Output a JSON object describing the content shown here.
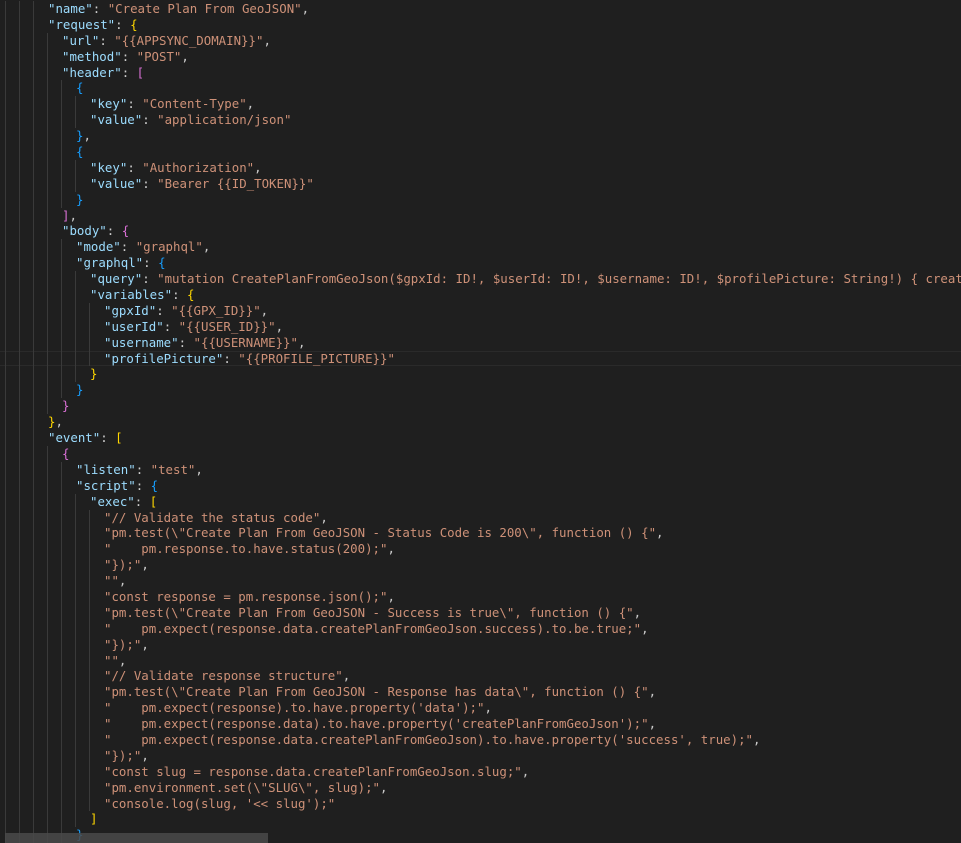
{
  "editor": {
    "lines": [
      [
        3,
        [
          [
            "k",
            "\"name\""
          ],
          [
            "p",
            ": "
          ],
          [
            "s",
            "\"Create Plan From GeoJSON\""
          ],
          [
            "p",
            ","
          ]
        ]
      ],
      [
        3,
        [
          [
            "k",
            "\"request\""
          ],
          [
            "p",
            ": "
          ],
          [
            "b1",
            "{"
          ]
        ]
      ],
      [
        4,
        [
          [
            "k",
            "\"url\""
          ],
          [
            "p",
            ": "
          ],
          [
            "s",
            "\"{{APPSYNC_DOMAIN}}\""
          ],
          [
            "p",
            ","
          ]
        ]
      ],
      [
        4,
        [
          [
            "k",
            "\"method\""
          ],
          [
            "p",
            ": "
          ],
          [
            "s",
            "\"POST\""
          ],
          [
            "p",
            ","
          ]
        ]
      ],
      [
        4,
        [
          [
            "k",
            "\"header\""
          ],
          [
            "p",
            ": "
          ],
          [
            "b2",
            "["
          ]
        ]
      ],
      [
        5,
        [
          [
            "b3",
            "{"
          ]
        ]
      ],
      [
        6,
        [
          [
            "k",
            "\"key\""
          ],
          [
            "p",
            ": "
          ],
          [
            "s",
            "\"Content-Type\""
          ],
          [
            "p",
            ","
          ]
        ]
      ],
      [
        6,
        [
          [
            "k",
            "\"value\""
          ],
          [
            "p",
            ": "
          ],
          [
            "s",
            "\"application/json\""
          ]
        ]
      ],
      [
        5,
        [
          [
            "b3",
            "}"
          ],
          [
            "p",
            ","
          ]
        ]
      ],
      [
        5,
        [
          [
            "b3",
            "{"
          ]
        ]
      ],
      [
        6,
        [
          [
            "k",
            "\"key\""
          ],
          [
            "p",
            ": "
          ],
          [
            "s",
            "\"Authorization\""
          ],
          [
            "p",
            ","
          ]
        ]
      ],
      [
        6,
        [
          [
            "k",
            "\"value\""
          ],
          [
            "p",
            ": "
          ],
          [
            "s",
            "\"Bearer {{ID_TOKEN}}\""
          ]
        ]
      ],
      [
        5,
        [
          [
            "b3",
            "}"
          ]
        ]
      ],
      [
        4,
        [
          [
            "b2",
            "]"
          ],
          [
            "p",
            ","
          ]
        ]
      ],
      [
        4,
        [
          [
            "k",
            "\"body\""
          ],
          [
            "p",
            ": "
          ],
          [
            "b2",
            "{"
          ]
        ]
      ],
      [
        5,
        [
          [
            "k",
            "\"mode\""
          ],
          [
            "p",
            ": "
          ],
          [
            "s",
            "\"graphql\""
          ],
          [
            "p",
            ","
          ]
        ]
      ],
      [
        5,
        [
          [
            "k",
            "\"graphql\""
          ],
          [
            "p",
            ": "
          ],
          [
            "b3",
            "{"
          ]
        ]
      ],
      [
        6,
        [
          [
            "k",
            "\"query\""
          ],
          [
            "p",
            ": "
          ],
          [
            "s",
            "\"mutation CreatePlanFromGeoJson($gpxId: ID!, $userId: ID!, $username: ID!, $profilePicture: String!) { createPlanFro"
          ]
        ]
      ],
      [
        6,
        [
          [
            "k",
            "\"variables\""
          ],
          [
            "p",
            ": "
          ],
          [
            "b1",
            "{"
          ]
        ]
      ],
      [
        7,
        [
          [
            "k",
            "\"gpxId\""
          ],
          [
            "p",
            ": "
          ],
          [
            "s",
            "\"{{GPX_ID}}\""
          ],
          [
            "p",
            ","
          ]
        ]
      ],
      [
        7,
        [
          [
            "k",
            "\"userId\""
          ],
          [
            "p",
            ": "
          ],
          [
            "s",
            "\"{{USER_ID}}\""
          ],
          [
            "p",
            ","
          ]
        ]
      ],
      [
        7,
        [
          [
            "k",
            "\"username\""
          ],
          [
            "p",
            ": "
          ],
          [
            "s",
            "\"{{USERNAME}}\""
          ],
          [
            "p",
            ","
          ]
        ]
      ],
      [
        7,
        [
          [
            "k",
            "\"profilePicture\""
          ],
          [
            "p",
            ": "
          ],
          [
            "s",
            "\"{{PROFILE_PICTURE}}\""
          ]
        ]
      ],
      [
        6,
        [
          [
            "b1",
            "}"
          ]
        ]
      ],
      [
        5,
        [
          [
            "b3",
            "}"
          ]
        ]
      ],
      [
        4,
        [
          [
            "b2",
            "}"
          ]
        ]
      ],
      [
        3,
        [
          [
            "b1",
            "}"
          ],
          [
            "p",
            ","
          ]
        ]
      ],
      [
        3,
        [
          [
            "k",
            "\"event\""
          ],
          [
            "p",
            ": "
          ],
          [
            "b1",
            "["
          ]
        ]
      ],
      [
        4,
        [
          [
            "b2",
            "{"
          ]
        ]
      ],
      [
        5,
        [
          [
            "k",
            "\"listen\""
          ],
          [
            "p",
            ": "
          ],
          [
            "s",
            "\"test\""
          ],
          [
            "p",
            ","
          ]
        ]
      ],
      [
        5,
        [
          [
            "k",
            "\"script\""
          ],
          [
            "p",
            ": "
          ],
          [
            "b3",
            "{"
          ]
        ]
      ],
      [
        6,
        [
          [
            "k",
            "\"exec\""
          ],
          [
            "p",
            ": "
          ],
          [
            "b1",
            "["
          ]
        ]
      ],
      [
        7,
        [
          [
            "s",
            "\"// Validate the status code\""
          ],
          [
            "p",
            ","
          ]
        ]
      ],
      [
        7,
        [
          [
            "s",
            "\"pm.test(\\\"Create Plan From GeoJSON - Status Code is 200\\\", function () {\""
          ],
          [
            "p",
            ","
          ]
        ]
      ],
      [
        7,
        [
          [
            "s",
            "\"    pm.response.to.have.status(200);\""
          ],
          [
            "p",
            ","
          ]
        ]
      ],
      [
        7,
        [
          [
            "s",
            "\"});\""
          ],
          [
            "p",
            ","
          ]
        ]
      ],
      [
        7,
        [
          [
            "s",
            "\"\""
          ],
          [
            "p",
            ","
          ]
        ]
      ],
      [
        7,
        [
          [
            "s",
            "\"const response = pm.response.json();\""
          ],
          [
            "p",
            ","
          ]
        ]
      ],
      [
        7,
        [
          [
            "s",
            "\"pm.test(\\\"Create Plan From GeoJSON - Success is true\\\", function () {\""
          ],
          [
            "p",
            ","
          ]
        ]
      ],
      [
        7,
        [
          [
            "s",
            "\"    pm.expect(response.data.createPlanFromGeoJson.success).to.be.true;\""
          ],
          [
            "p",
            ","
          ]
        ]
      ],
      [
        7,
        [
          [
            "s",
            "\"});\""
          ],
          [
            "p",
            ","
          ]
        ]
      ],
      [
        7,
        [
          [
            "s",
            "\"\""
          ],
          [
            "p",
            ","
          ]
        ]
      ],
      [
        7,
        [
          [
            "s",
            "\"// Validate response structure\""
          ],
          [
            "p",
            ","
          ]
        ]
      ],
      [
        7,
        [
          [
            "s",
            "\"pm.test(\\\"Create Plan From GeoJSON - Response has data\\\", function () {\""
          ],
          [
            "p",
            ","
          ]
        ]
      ],
      [
        7,
        [
          [
            "s",
            "\"    pm.expect(response).to.have.property('data');\""
          ],
          [
            "p",
            ","
          ]
        ]
      ],
      [
        7,
        [
          [
            "s",
            "\"    pm.expect(response.data).to.have.property('createPlanFromGeoJson');\""
          ],
          [
            "p",
            ","
          ]
        ]
      ],
      [
        7,
        [
          [
            "s",
            "\"    pm.expect(response.data.createPlanFromGeoJson).to.have.property('success', true);\""
          ],
          [
            "p",
            ","
          ]
        ]
      ],
      [
        7,
        [
          [
            "s",
            "\"});\""
          ],
          [
            "p",
            ","
          ]
        ]
      ],
      [
        7,
        [
          [
            "s",
            "\"const slug = response.data.createPlanFromGeoJson.slug;\""
          ],
          [
            "p",
            ","
          ]
        ]
      ],
      [
        7,
        [
          [
            "s",
            "\"pm.environment.set(\\\"SLUG\\\", slug);\""
          ],
          [
            "p",
            ","
          ]
        ]
      ],
      [
        7,
        [
          [
            "s",
            "\"console.log(slug, '<< slug');\""
          ]
        ]
      ],
      [
        6,
        [
          [
            "b1",
            "]"
          ]
        ]
      ],
      [
        5,
        [
          [
            "b3",
            "}"
          ]
        ]
      ]
    ]
  },
  "colors": {
    "background": "#1f1f1f",
    "key": "#9cdcfe",
    "string": "#ce9178",
    "punctuation": "#cccccc",
    "bracket_level_1": "#ffd700",
    "bracket_level_2": "#da70d6",
    "bracket_level_3": "#179fff"
  }
}
